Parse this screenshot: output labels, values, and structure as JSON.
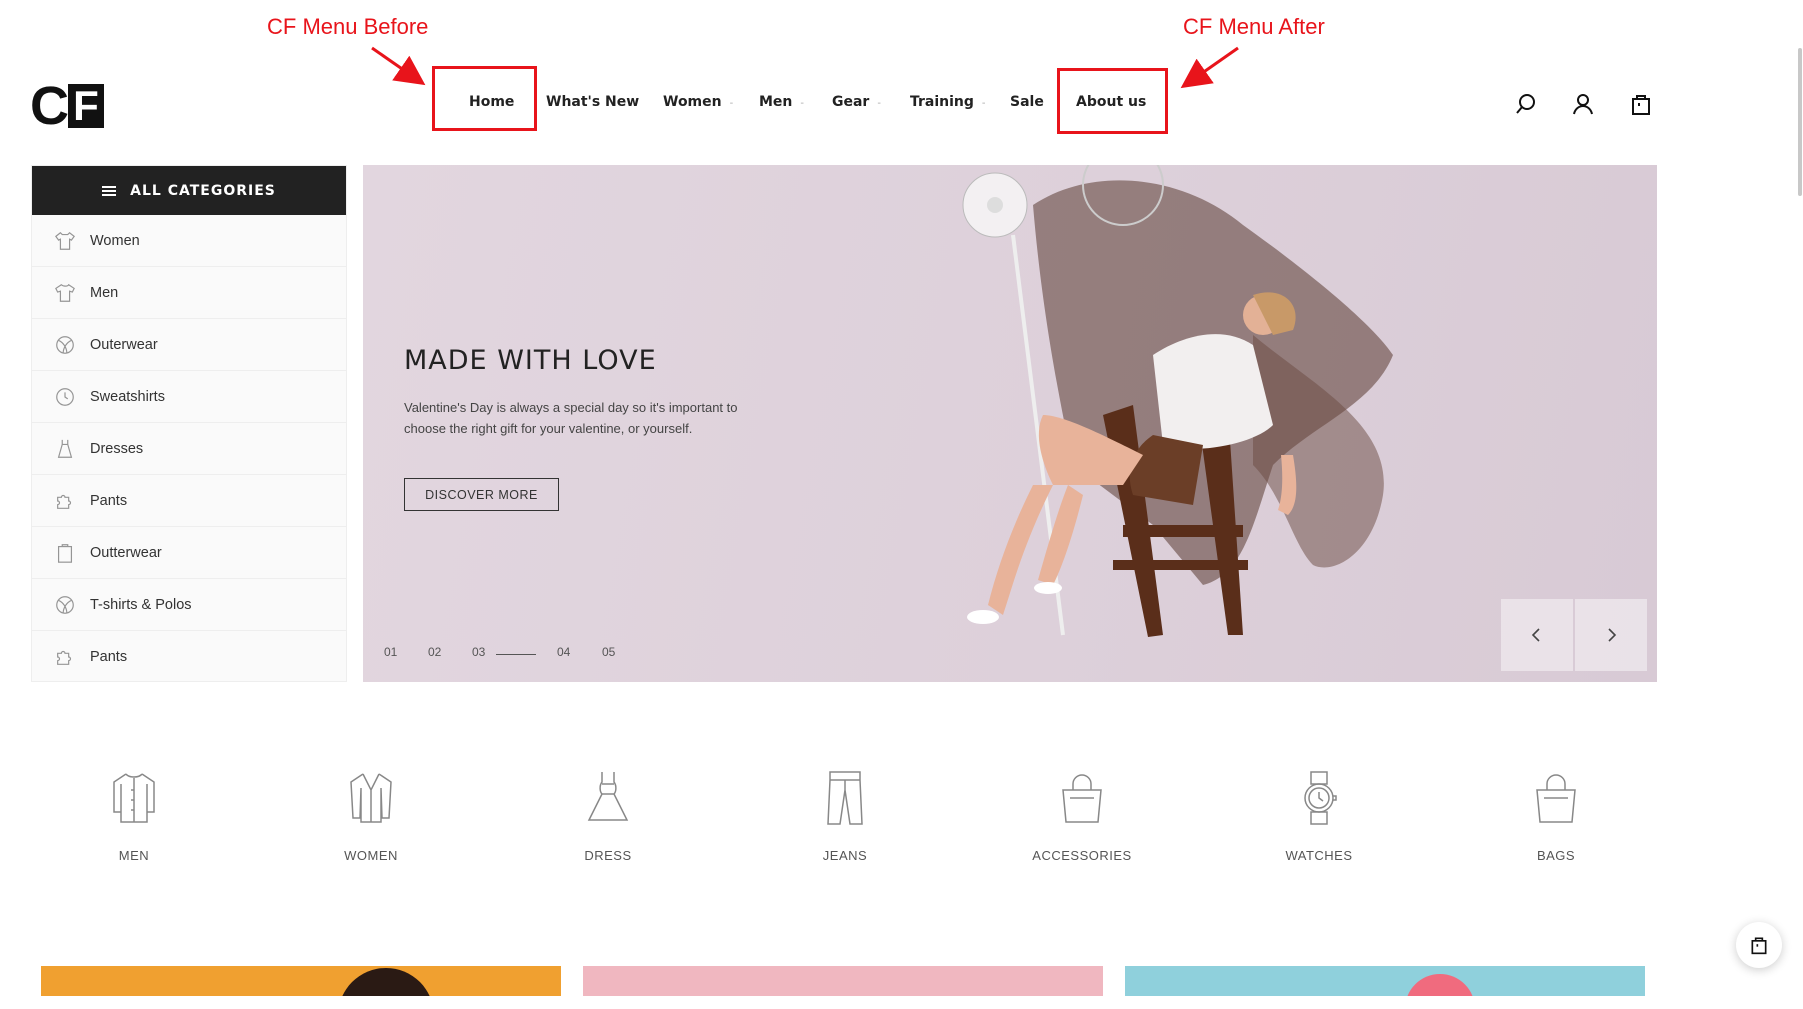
{
  "annotations": {
    "before_label": "CF Menu Before",
    "after_label": "CF Menu After",
    "color": "#e8141b"
  },
  "logo": {
    "text_c": "C",
    "text_f": "F"
  },
  "nav": {
    "items": [
      {
        "label": "Home",
        "has_caret": false
      },
      {
        "label": "What's New",
        "has_caret": false
      },
      {
        "label": "Women",
        "has_caret": true
      },
      {
        "label": "Men",
        "has_caret": true
      },
      {
        "label": "Gear",
        "has_caret": true
      },
      {
        "label": "Training",
        "has_caret": true
      },
      {
        "label": "Sale",
        "has_caret": false
      },
      {
        "label": "About us",
        "has_caret": false
      }
    ],
    "caret": "-"
  },
  "header_icons": [
    "search-icon",
    "user-icon",
    "bag-icon"
  ],
  "sidebar": {
    "title": "ALL CATEGORIES",
    "items": [
      {
        "label": "Women",
        "icon": "shirt-icon"
      },
      {
        "label": "Men",
        "icon": "tshirt-icon"
      },
      {
        "label": "Outerwear",
        "icon": "ball-icon"
      },
      {
        "label": "Sweatshirts",
        "icon": "clock-icon"
      },
      {
        "label": "Dresses",
        "icon": "dress-icon"
      },
      {
        "label": "Pants",
        "icon": "puzzle-icon"
      },
      {
        "label": "Outterwear",
        "icon": "bag-outline-icon"
      },
      {
        "label": "T-shirts & Polos",
        "icon": "ball-icon"
      },
      {
        "label": "Pants",
        "icon": "puzzle-icon"
      }
    ]
  },
  "hero": {
    "title": "MADE WITH LOVE",
    "text": "Valentine's Day is always a special day so it's important to choose the right gift for your valentine, or yourself.",
    "button": "DISCOVER MORE",
    "slides": [
      "01",
      "02",
      "03",
      "04",
      "05"
    ],
    "active_slide": "03",
    "prev_icon": "chevron-left-icon",
    "next_icon": "chevron-right-icon"
  },
  "categories": [
    {
      "label": "MEN",
      "icon": "shirt-icon"
    },
    {
      "label": "WOMEN",
      "icon": "cardigan-icon"
    },
    {
      "label": "DRESS",
      "icon": "dress-icon"
    },
    {
      "label": "JEANS",
      "icon": "jeans-icon"
    },
    {
      "label": "ACCESSORIES",
      "icon": "handbag-icon"
    },
    {
      "label": "WATCHES",
      "icon": "watch-icon"
    },
    {
      "label": "BAGS",
      "icon": "bag-icon"
    }
  ],
  "banners": [
    {
      "color": "#f0a030"
    },
    {
      "color": "#f0b7c0"
    },
    {
      "color": "#8fd0dc"
    }
  ]
}
